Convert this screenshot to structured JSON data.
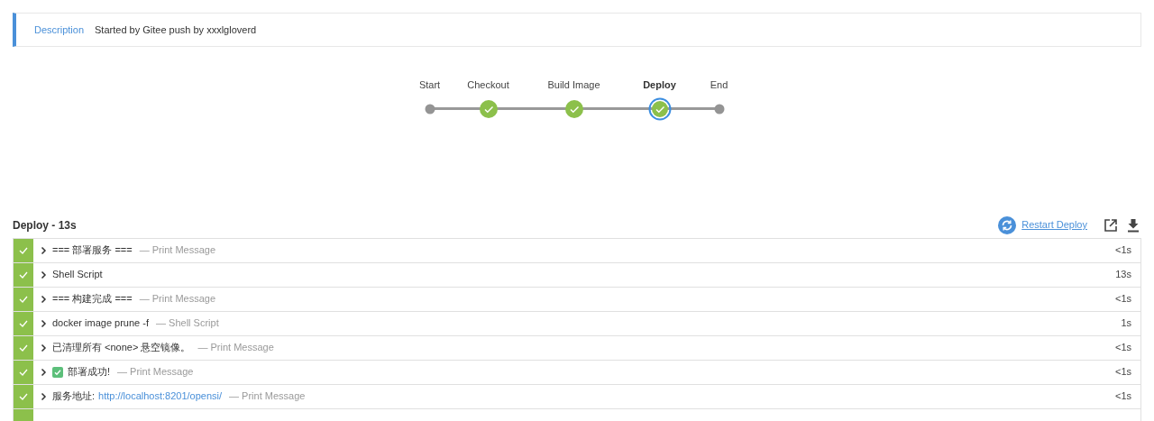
{
  "description": {
    "label": "Description",
    "text": "Started by Gitee push by xxxlgloverd"
  },
  "stages": [
    {
      "label": "Start",
      "kind": "plain",
      "selected": false
    },
    {
      "label": "Checkout",
      "kind": "success",
      "selected": false
    },
    {
      "label": "Build Image",
      "kind": "success",
      "selected": false
    },
    {
      "label": "Deploy",
      "kind": "success",
      "selected": true
    },
    {
      "label": "End",
      "kind": "plain",
      "selected": false
    }
  ],
  "step_panel": {
    "title": "Deploy - 13s",
    "restart": "Restart Deploy"
  },
  "steps": [
    {
      "passed": true,
      "title": "=== 部署服务 ===",
      "type": "— Print Message",
      "duration": "<1s"
    },
    {
      "passed": true,
      "title": "Shell Script",
      "duration": "13s"
    },
    {
      "passed": true,
      "title": "=== 构建完成 ===",
      "type": "— Print Message",
      "duration": "<1s"
    },
    {
      "passed": true,
      "title": "docker image prune -f",
      "type": "— Shell Script",
      "duration": "1s"
    },
    {
      "passed": true,
      "title": "已清理所有 <none> 悬空镜像。",
      "type": "— Print Message",
      "duration": "<1s"
    },
    {
      "passed": true,
      "check_badge": true,
      "title": "部署成功!",
      "type": "— Print Message",
      "duration": "<1s"
    },
    {
      "passed": true,
      "title": "服务地址:",
      "link": "http://localhost:8201/opensi/",
      "type": "— Print Message",
      "duration": "<1s"
    },
    {
      "passed": true
    }
  ]
}
